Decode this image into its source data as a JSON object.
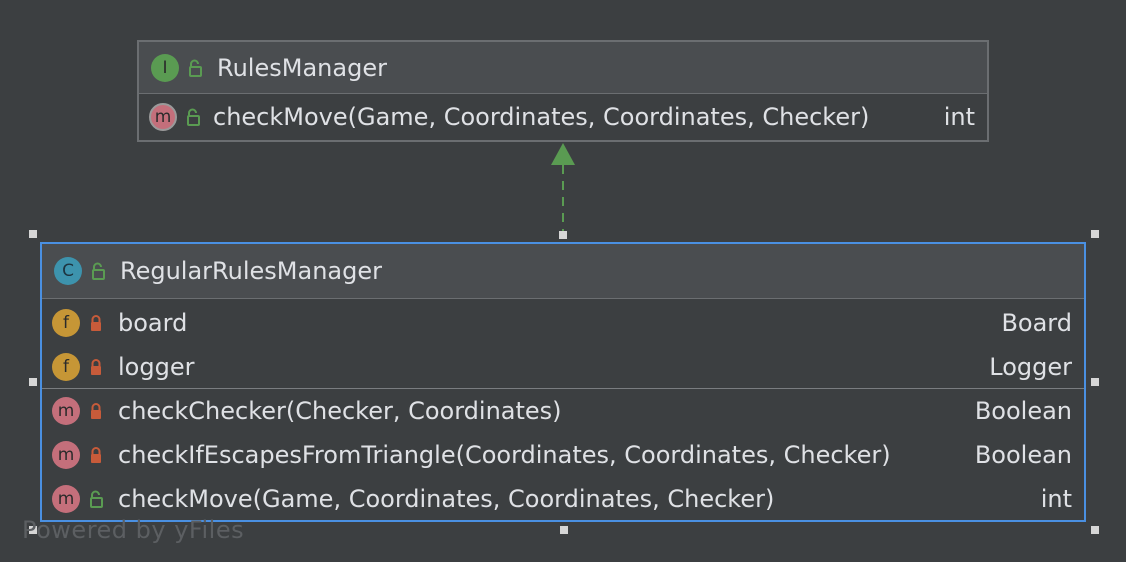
{
  "interface_node": {
    "badge": "I",
    "name": "RulesManager",
    "method": {
      "badge": "m",
      "signature": "checkMove(Game, Coordinates, Coordinates, Checker)",
      "type": "int"
    }
  },
  "class_node": {
    "badge": "C",
    "name": "RegularRulesManager",
    "fields": [
      {
        "badge": "f",
        "name": "board",
        "type": "Board"
      },
      {
        "badge": "f",
        "name": "logger",
        "type": "Logger"
      }
    ],
    "methods": [
      {
        "badge": "m",
        "signature": "checkChecker(Checker, Coordinates)",
        "type": "Boolean"
      },
      {
        "badge": "m",
        "signature": "checkIfEscapesFromTriangle(Coordinates, Coordinates, Checker)",
        "type": "Boolean"
      },
      {
        "badge": "m",
        "signature": "checkMove(Game, Coordinates, Coordinates, Checker)",
        "type": "int"
      }
    ]
  },
  "watermark": "Powered by yFiles",
  "colors": {
    "background": "#3c3f41",
    "selection": "#4a90e2",
    "arrow": "#5a9b52",
    "public_lock": "#5a9b52",
    "private_lock": "#c75b3a"
  },
  "icons": {
    "public": "open-padlock-icon",
    "private": "closed-padlock-icon"
  }
}
